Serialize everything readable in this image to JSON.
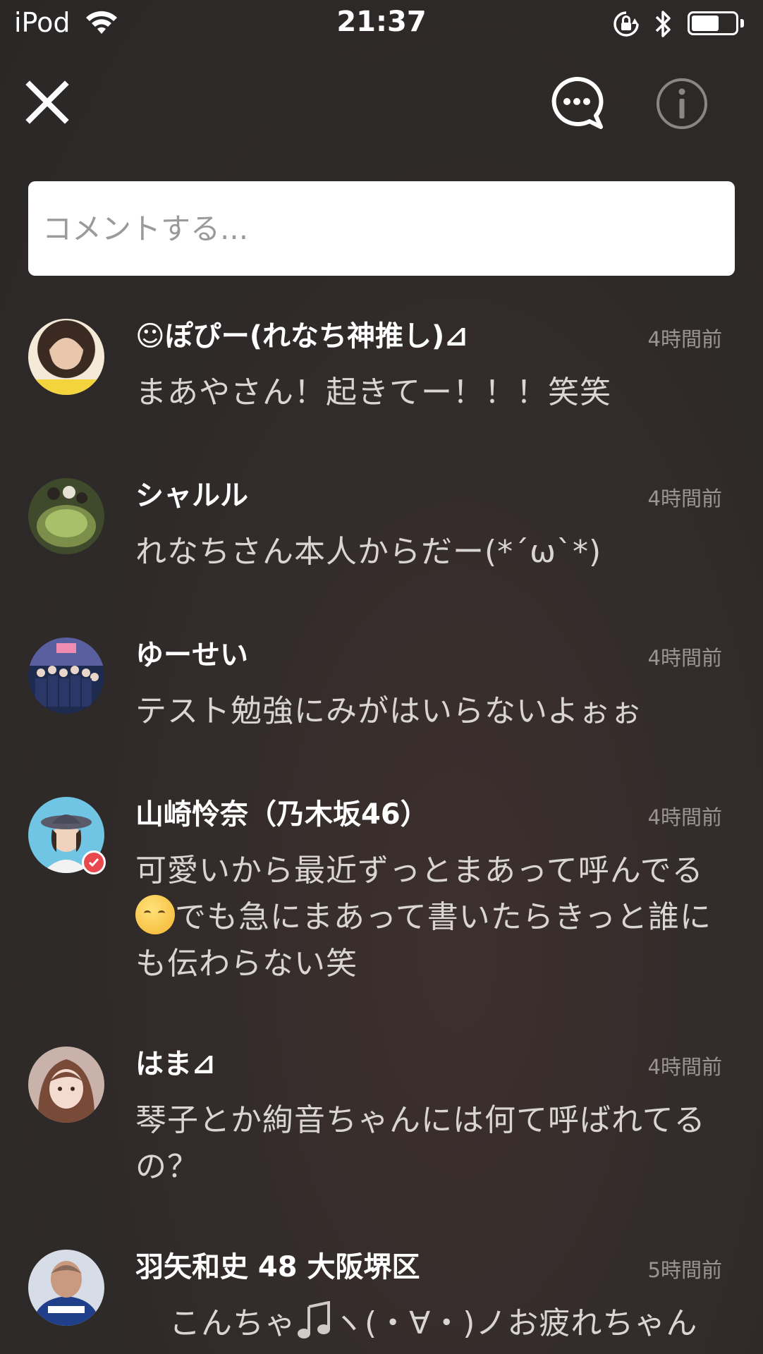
{
  "status_bar": {
    "carrier": "iPod",
    "time": "21:37"
  },
  "header": {
    "close_icon": "close-icon",
    "chat_icon": "chat-bubble-icon",
    "info_icon": "info-icon"
  },
  "comment_input": {
    "placeholder": "コメントする..."
  },
  "comments": [
    {
      "name": "☺ぽぴー(れなち神推し)⊿",
      "time": "4時間前",
      "text": "まあやさん！起きてー！！！笑笑",
      "avatar_color": "#c8a98f"
    },
    {
      "name": "シャルル",
      "time": "4時間前",
      "text": "れなちさん本人からだー(*´ω`*)",
      "avatar_color": "#5b6a3e"
    },
    {
      "name": "ゆーせい",
      "time": "4時間前",
      "text": "テスト勉強にみがはいらないよぉぉ",
      "avatar_color": "#3a4d78"
    },
    {
      "name": "山崎怜奈（乃木坂46）",
      "time": "4時間前",
      "text_part1": "可愛いから最近ずっとまあって呼んでる",
      "text_part2": "でも急にまあって書いたらきっと誰にも伝わらない笑",
      "avatar_color": "#69c3e0",
      "verified": true
    },
    {
      "name": "はま⊿",
      "time": "4時間前",
      "text": "琴子とか絢音ちゃんには何て呼ばれてるの？",
      "avatar_color": "#b69a90"
    },
    {
      "name": "羽矢和史 48 大阪堺区",
      "time": "5時間前",
      "text_part1": "こんちゃ",
      "text_part2": "ヽ(・∀・)ノお疲れちゃん",
      "avatar_color": "#1f3f8a"
    }
  ]
}
